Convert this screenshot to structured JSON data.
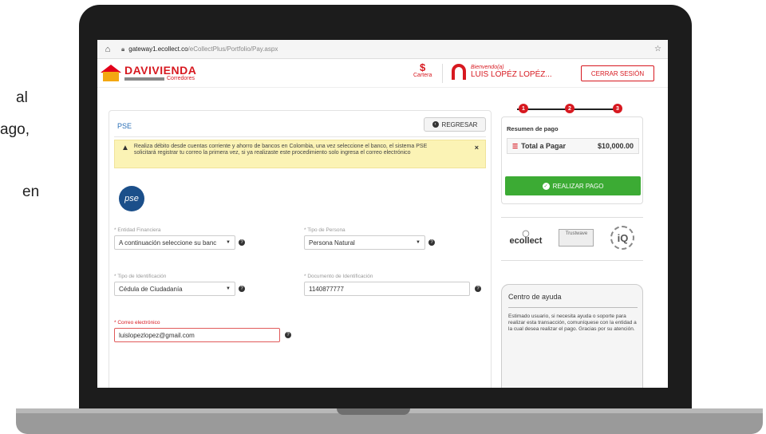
{
  "side_text": [
    "al",
    "ago,",
    "en"
  ],
  "browser": {
    "url_host": "gateway1.ecollect.co",
    "url_path": "/eCollectPlus/Portfolio/Pay.aspx"
  },
  "header": {
    "logo_name": "DAVIVIENDA",
    "logo_sub": "Corredores",
    "cartera_symbol": "$",
    "cartera_label": "Cartera",
    "welcome": "Bienvendo(a)",
    "username": "LUIS LOPÉZ LOPÉZ...",
    "logout_label": "CERRAR SESIÓN"
  },
  "steps": [
    "1",
    "2",
    "3"
  ],
  "form": {
    "tab_label": "PSE",
    "back_label": "REGRESAR",
    "alert_text": "Realiza débito desde cuentas corriente y ahorro de bancos en Colombia, una vez seleccione el banco, el sistema PSE solicitará registrar tu correo la primera vez, si ya realizaste este procedimiento solo ingresa el correo electrónico",
    "alert_close": "×",
    "pse_logo": "pse",
    "entidad_label": "* Entidad Financiera",
    "entidad_value": "A continuación seleccione su banc",
    "persona_label": "* Tipo de Persona",
    "persona_value": "Persona Natural",
    "tipo_id_label": "* Tipo de Identificación",
    "tipo_id_value": "Cédula de Ciudadanía",
    "documento_label": "* Documento de Identificación",
    "documento_value": "1140877777",
    "correo_label": "* Correo electrónico",
    "correo_value": "luislopezlopez@gmail.com"
  },
  "summary": {
    "title": "Resumen de pago",
    "total_label": "Total a Pagar",
    "total_amount": "$10,000.00",
    "pay_label": "REALIZAR PAGO"
  },
  "badges": {
    "ecollect": "ecollect",
    "trustwave": "Trustwave",
    "iq": "iQ"
  },
  "help": {
    "title": "Centro de ayuda",
    "text": "Estimado usuario, si necesita ayuda o soporte para realizar esta transacción, comuníquese con la entidad a la cual desea realizar el pago. Gracias por su atención."
  },
  "colors": {
    "brand_red": "#d71920",
    "pay_green": "#3cab34",
    "alert_yellow": "#fbf3b5"
  }
}
